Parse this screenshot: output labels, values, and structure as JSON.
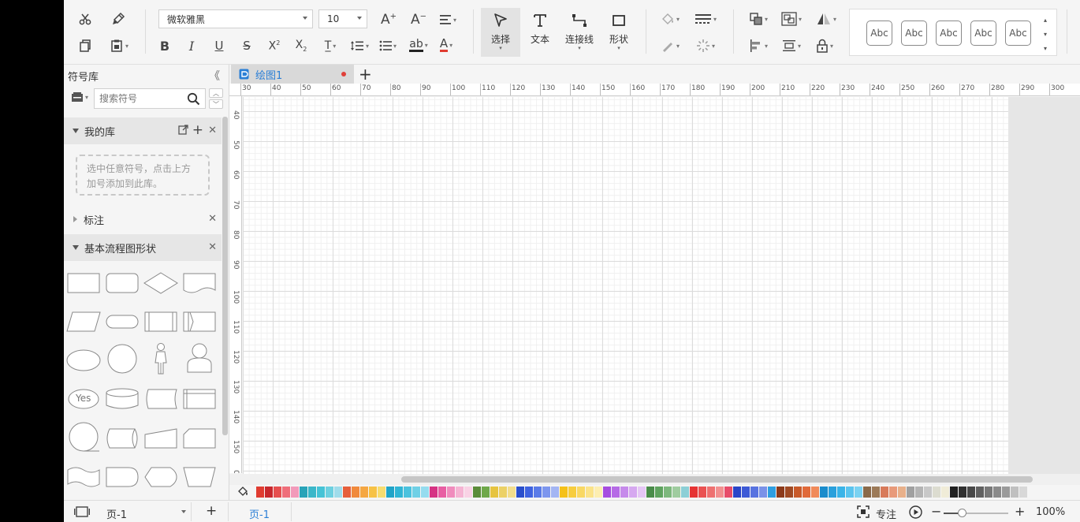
{
  "toolbar": {
    "font_family": "微软雅黑",
    "font_size": "10",
    "tools": {
      "select": "选择",
      "text": "文本",
      "connector": "连接线",
      "shape": "形状"
    },
    "style_cards": [
      "Abc",
      "Abc",
      "Abc",
      "Abc",
      "Abc"
    ]
  },
  "sidebar": {
    "title": "符号库",
    "search_placeholder": "搜索符号",
    "my_library": {
      "title": "我的库",
      "hint": "选中任意符号，点击上方加号添加到此库。"
    },
    "annotation": {
      "title": "标注"
    },
    "basic_flowchart": {
      "title": "基本流程图形状",
      "yes_label": "Yes"
    }
  },
  "tabs": [
    {
      "label": "绘图1",
      "modified": true
    }
  ],
  "ruler": {
    "h_labels": [
      "30",
      "40",
      "50",
      "60",
      "70",
      "80",
      "90",
      "100",
      "110",
      "120",
      "130",
      "140",
      "150",
      "160",
      "170",
      "180",
      "190",
      "200",
      "210",
      "220",
      "230",
      "240",
      "250",
      "260",
      "270",
      "280",
      "290",
      "300"
    ],
    "v_labels": [
      "40",
      "50",
      "60",
      "70",
      "80",
      "90",
      "100",
      "110",
      "120",
      "130",
      "140",
      "150",
      "0"
    ]
  },
  "palette": {
    "colors": [
      "#e03c31",
      "#c8282d",
      "#e64f4f",
      "#ef6e7a",
      "#f29aba",
      "#29a3b8",
      "#3bb7c9",
      "#45c3d6",
      "#6dd0e0",
      "#9fdceb",
      "#e65f3c",
      "#f08a3d",
      "#f5a742",
      "#f7c245",
      "#f7dc6f",
      "#20a4c8",
      "#30b5d5",
      "#4bc2de",
      "#6fd0e6",
      "#95dcef",
      "#d63384",
      "#e85ea3",
      "#f08cbd",
      "#f5b4d3",
      "#f9d2e5",
      "#5b8c3a",
      "#6fa84a",
      "#e6c440",
      "#ecd166",
      "#f2dd8c",
      "#2a4fcc",
      "#3f63e0",
      "#5a7be8",
      "#7d96ee",
      "#a3b5f3",
      "#f5c118",
      "#f7cd3e",
      "#f9d863",
      "#fbe389",
      "#fdeeb0",
      "#a64de0",
      "#b66be6",
      "#c68aeb",
      "#d6a8f0",
      "#e5c6f5",
      "#4a8c4a",
      "#5fa35f",
      "#7db87d",
      "#9fcc9f",
      "#8ccfd6",
      "#e63333",
      "#ea5252",
      "#ee7171",
      "#f29090",
      "#e84d6a",
      "#2a45c8",
      "#3d5ad6",
      "#5873e0",
      "#7a92e8",
      "#2e9ee0",
      "#8c3a1a",
      "#a04a24",
      "#c85a2a",
      "#e06a3a",
      "#f08a5a",
      "#1a8ccc",
      "#2aa0dc",
      "#3ab4e8",
      "#5ac4ee",
      "#7ad2f2",
      "#8a6a4a",
      "#9c7a58",
      "#d87a5a",
      "#e89a7a",
      "#e8b08a",
      "#a0a0a0",
      "#b4b4b4",
      "#c8c8c8",
      "#dcdcd0",
      "#f0ecd8",
      "#202020",
      "#303030",
      "#484848",
      "#606060",
      "#787878",
      "#8a8a8a",
      "#9a9a9a",
      "#c0c0c0",
      "#d8d8d8"
    ]
  },
  "status": {
    "page_label": "页-1",
    "active_page": "页-1",
    "focus": "专注",
    "zoom": "100%"
  }
}
